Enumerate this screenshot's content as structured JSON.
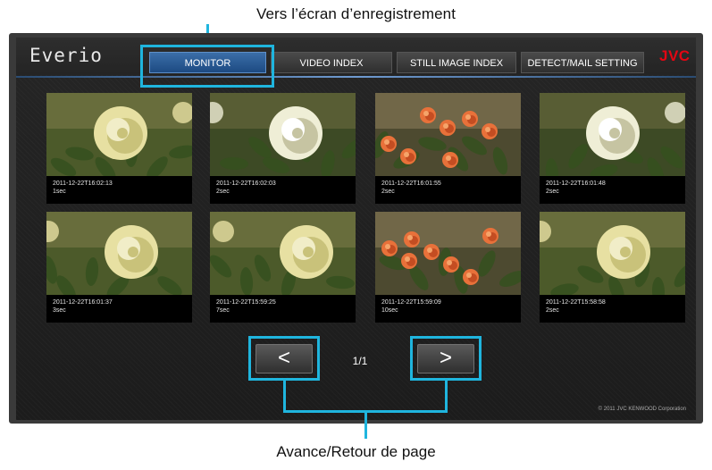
{
  "annotations": {
    "top_caption": "Vers l’écran d’enregistrement",
    "bottom_caption": "Avance/Retour de page",
    "accent_color": "#1fb5de"
  },
  "header": {
    "logo": "Everio",
    "brand": "JVC",
    "tabs": [
      {
        "label": "MONITOR",
        "active": true
      },
      {
        "label": "VIDEO INDEX",
        "active": false
      },
      {
        "label": "STILL IMAGE INDEX",
        "active": false
      },
      {
        "label": "DETECT/MAIL SETTING",
        "active": false
      }
    ]
  },
  "videos": [
    {
      "timestamp": "2011-12-22T16:02:13",
      "duration": "1sec",
      "subject": "yellow-rose"
    },
    {
      "timestamp": "2011-12-22T16:02:03",
      "duration": "2sec",
      "subject": "white-rose"
    },
    {
      "timestamp": "2011-12-22T16:01:55",
      "duration": "2sec",
      "subject": "orange-flowers"
    },
    {
      "timestamp": "2011-12-22T16:01:48",
      "duration": "2sec",
      "subject": "white-rose"
    },
    {
      "timestamp": "2011-12-22T16:01:37",
      "duration": "3sec",
      "subject": "yellow-rose"
    },
    {
      "timestamp": "2011-12-22T15:59:25",
      "duration": "7sec",
      "subject": "yellow-rose"
    },
    {
      "timestamp": "2011-12-22T15:59:09",
      "duration": "10sec",
      "subject": "orange-flowers"
    },
    {
      "timestamp": "2011-12-22T15:58:58",
      "duration": "2sec",
      "subject": "yellow-rose"
    }
  ],
  "pager": {
    "prev_label": "<",
    "next_label": ">",
    "page": "1/1"
  },
  "footer": {
    "copyright": "© 2011 JVC KENWOOD Corporation"
  }
}
